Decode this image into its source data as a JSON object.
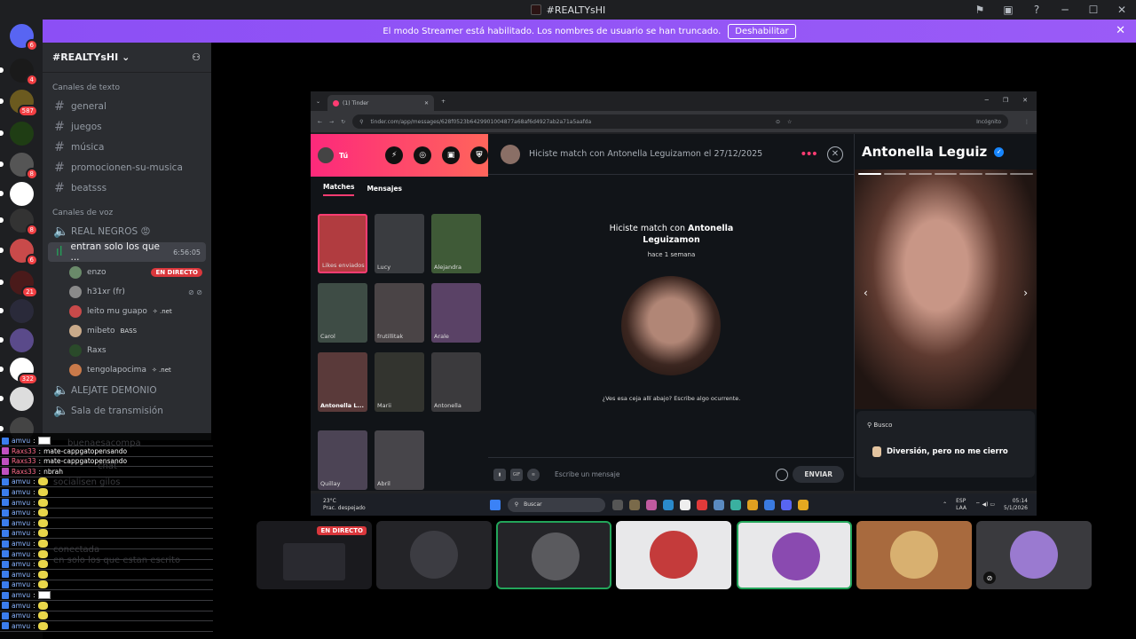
{
  "titlebar": {
    "title": "#REALTYsHI"
  },
  "banner": {
    "text": "El modo Streamer está habilitado. Los nombres de usuario se han truncado.",
    "button": "Deshabilitar"
  },
  "servers": [
    {
      "badge": "6",
      "color": "#5865f2"
    },
    {
      "badge": "4",
      "color": "#1a1a1a"
    },
    {
      "badge": "587",
      "color": "#6b5a1f"
    },
    {
      "badge": "",
      "color": "#1f3d14"
    },
    {
      "badge": "8",
      "color": "#555555"
    },
    {
      "badge": "",
      "color": "#ffffff"
    },
    {
      "badge": "8",
      "color": "#333333"
    },
    {
      "badge": "6",
      "color": "#c94a4a"
    },
    {
      "badge": "21",
      "color": "#4a1a1a"
    },
    {
      "badge": "",
      "color": "#2a2a3a"
    },
    {
      "badge": "",
      "color": "#5a4a8a"
    },
    {
      "badge": "322",
      "color": "#ffffff"
    },
    {
      "badge": "",
      "color": "#dddddd"
    },
    {
      "badge": "",
      "color": "#444444"
    }
  ],
  "guild": {
    "name": "#REALTYsHI"
  },
  "text_category": "Canales de texto",
  "text_channels": [
    "general",
    "juegos",
    "música",
    "promocionen-su-musica",
    "beatsss"
  ],
  "voice_category": "Canales de voz",
  "voice_channels": [
    {
      "name": "REAL NEGROS 😡"
    },
    {
      "name": "entran solo los que ...",
      "time": "6:56:05"
    }
  ],
  "voice_users": [
    {
      "name": "enzo",
      "live": "EN DIRECTO",
      "color": "#6a8a6a"
    },
    {
      "name": "h31xr (fr)",
      "color": "#8a8a8a"
    },
    {
      "name": "leito mu guapo",
      "tag": "✧ .net",
      "color": "#c94a4a"
    },
    {
      "name": "mibeto",
      "tag": "BASS",
      "color": "#c9aa8a"
    },
    {
      "name": "Raxs",
      "color": "#2a4a2a"
    },
    {
      "name": "tengolapocima",
      "tag": "✧ .net",
      "color": "#c97a4a"
    }
  ],
  "more_voice_channels": [
    "ALEJATE DEMONIO",
    "Sala de transmisión"
  ],
  "chat": [
    {
      "nick": "amvu",
      "kind": "box",
      "text": ""
    },
    {
      "nick": "Raxs33",
      "kind": "text",
      "text": "mate-cappgatopensando",
      "pink": true
    },
    {
      "nick": "Raxs33",
      "kind": "text",
      "text": "mate-cappgatopensando",
      "pink": true
    },
    {
      "nick": "Raxs33",
      "kind": "text",
      "text": "nbrah",
      "pink": true
    },
    {
      "nick": "amvu",
      "kind": "emo",
      "text": ""
    },
    {
      "nick": "amvu",
      "kind": "emo",
      "text": ""
    },
    {
      "nick": "amvu",
      "kind": "emo",
      "text": ""
    },
    {
      "nick": "amvu",
      "kind": "emo",
      "text": ""
    },
    {
      "nick": "amvu",
      "kind": "emo",
      "text": ""
    },
    {
      "nick": "amvu",
      "kind": "emo",
      "text": ""
    },
    {
      "nick": "amvu",
      "kind": "emo",
      "text": ""
    },
    {
      "nick": "amvu",
      "kind": "emo",
      "text": ""
    },
    {
      "nick": "amvu",
      "kind": "emo",
      "text": ""
    },
    {
      "nick": "amvu",
      "kind": "emo",
      "text": ""
    },
    {
      "nick": "amvu",
      "kind": "emo",
      "text": ""
    },
    {
      "nick": "amvu",
      "kind": "box",
      "text": ""
    },
    {
      "nick": "amvu",
      "kind": "emo",
      "text": ""
    },
    {
      "nick": "amvu",
      "kind": "emo",
      "text": ""
    },
    {
      "nick": "amvu",
      "kind": "emo",
      "text": ""
    }
  ],
  "chat_ghost": [
    "buenaesacompa",
    "chat",
    "socialisen gilos",
    "conectada",
    "en solo los que estan escrito"
  ],
  "browser": {
    "tab_title": "(1) Tinder",
    "url": "tinder.com/app/messages/628f0523b6429901004877a68af6d4927ab2a71a5aafda",
    "incognito": "Incógnito"
  },
  "tinder": {
    "me_label": "Tú",
    "tabs": [
      "Matches",
      "Mensajes"
    ],
    "matches": [
      {
        "name": "Likes enviados",
        "color": "#b13c40",
        "bold": false
      },
      {
        "name": "Lucy",
        "color": "#3a3c40",
        "bold": false
      },
      {
        "name": "Alejandra",
        "color": "#3f5a37",
        "bold": false
      },
      {
        "name": "Carol",
        "color": "#3e4c45",
        "bold": false
      },
      {
        "name": "frutillitak",
        "color": "#4a4446",
        "bold": false
      },
      {
        "name": "Arale",
        "color": "#5a4266",
        "bold": false
      },
      {
        "name": "Antonella L...",
        "color": "#5a3a3a",
        "bold": true
      },
      {
        "name": "Marii",
        "color": "#33342f",
        "bold": false
      },
      {
        "name": "Antonella",
        "color": "#3b3a3d",
        "bold": false
      },
      {
        "name": "Quillay",
        "color": "#4c4455",
        "bold": false
      },
      {
        "name": "Abril",
        "color": "#47454a",
        "bold": false
      }
    ],
    "header": "Hiciste match con Antonella Leguizamon el 27/12/2025",
    "match_prefix": "Hiciste match con",
    "match_name_1": "Antonella",
    "match_name_2": "Leguizamon",
    "match_time": "hace 1 semana",
    "prompt": "¿Ves esa ceja allí abajo? Escribe algo ocurrente.",
    "placeholder": "Escribe un mensaje",
    "send": "ENVIAR",
    "profile_name": "Antonella Leguiz",
    "looking_label": "Busco",
    "looking_value": "Diversión, pero no me cierro",
    "brand_color": "#fe3c72"
  },
  "taskbar": {
    "temp": "23°C",
    "weather": "Prac. despejado",
    "search": "Buscar",
    "lang1": "ESP",
    "lang2": "LAA",
    "time": "05:14",
    "date": "5/1/2026"
  },
  "tiles": [
    {
      "live": "EN DIRECTO",
      "bg": "#1a1a1e",
      "av": ""
    },
    {
      "live": "",
      "bg": "#242428",
      "av": "#3c3c42"
    },
    {
      "live": "",
      "bg": "#242428",
      "av": "#5a5a5e"
    },
    {
      "live": "",
      "bg": "#e8e8ea",
      "av": "#c43b3b"
    },
    {
      "live": "",
      "bg": "#e8e8ea",
      "av": "#8a4ab0"
    },
    {
      "live": "",
      "bg": "#a86a3e",
      "av": "#d8b070"
    },
    {
      "live": "",
      "bg": "#3a3a3e",
      "av": "#9a7ad0"
    }
  ]
}
